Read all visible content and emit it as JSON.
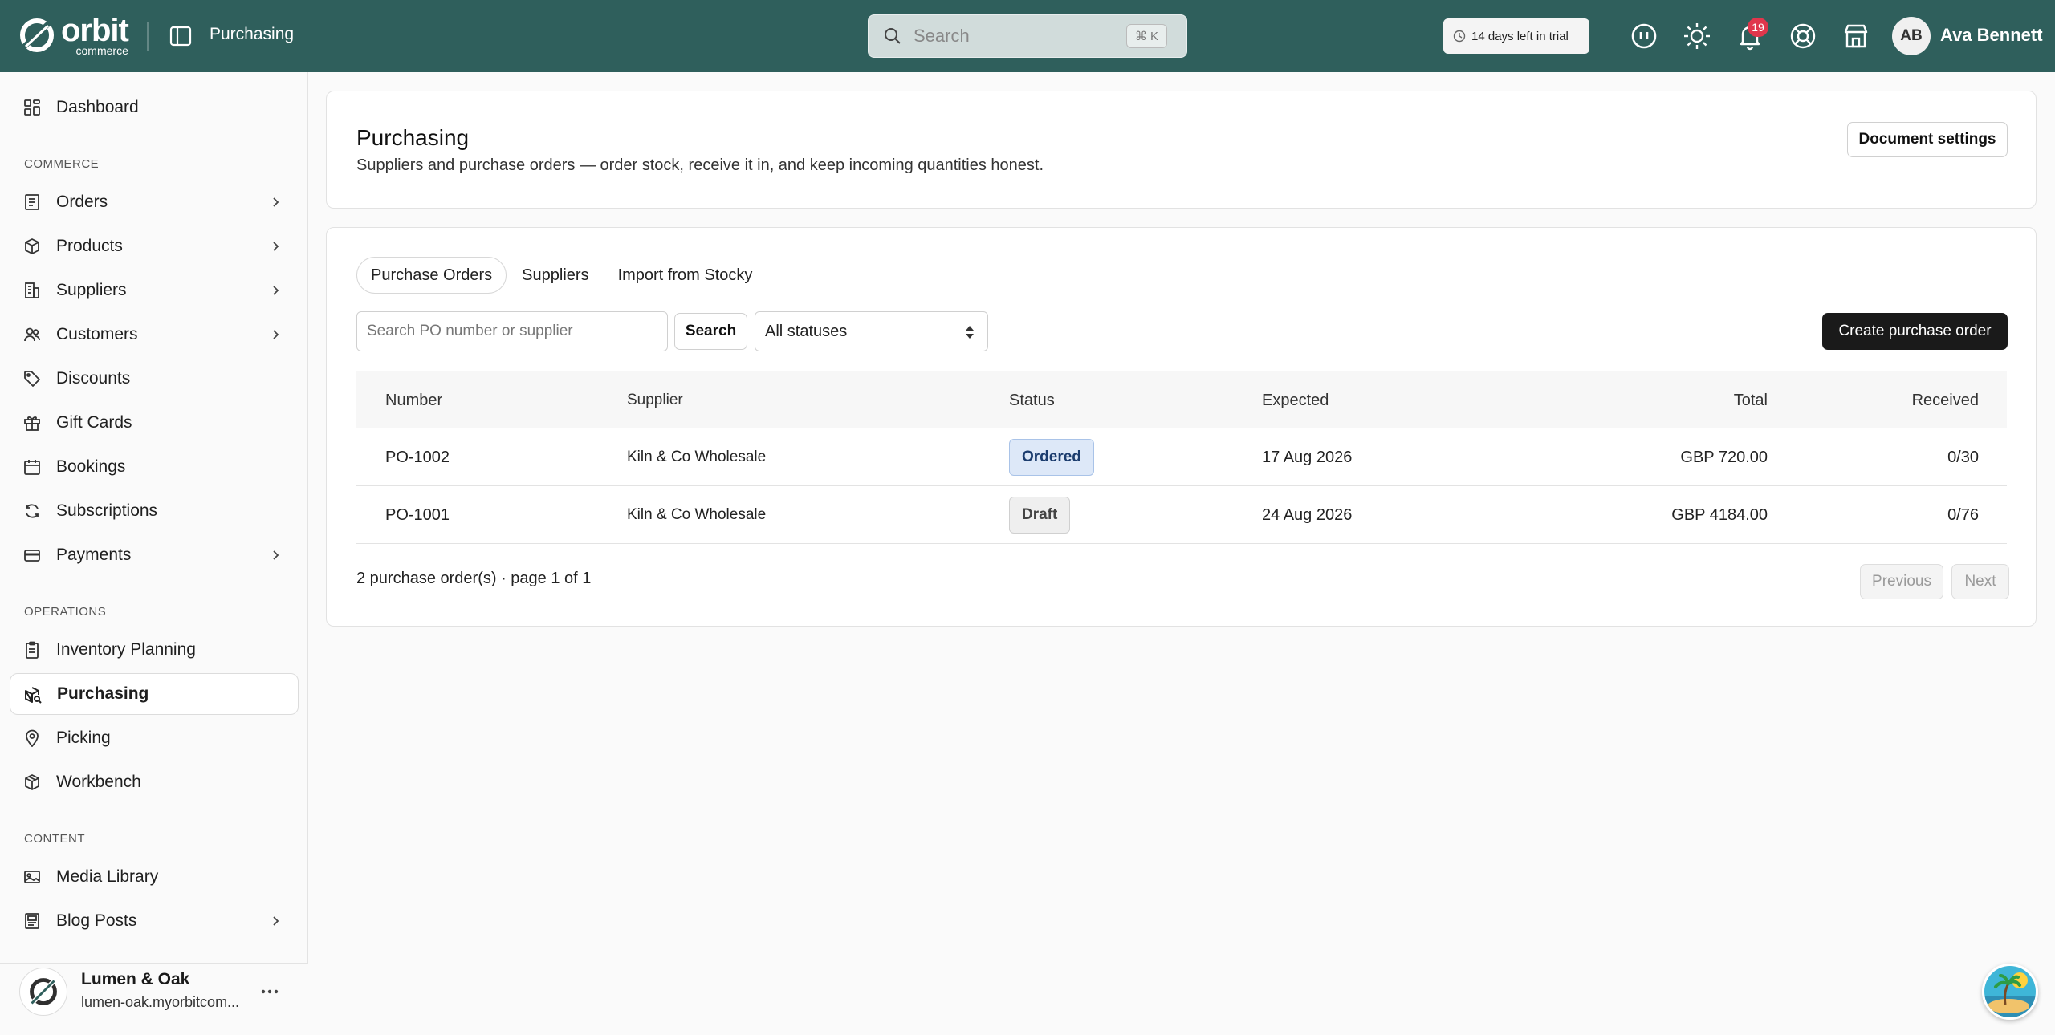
{
  "brand": {
    "name": "orbit",
    "sub": "commerce"
  },
  "topbar": {
    "section_title": "Purchasing",
    "search_placeholder": "Search",
    "search_shortcut": "⌘ K",
    "trial_text": "14 days left in trial",
    "notifications_count": "19",
    "user_initials": "AB",
    "user_name": "Ava Bennett",
    "icons": [
      "feedback-icon",
      "theme-toggle-icon",
      "bell-icon",
      "help-icon",
      "store-icon"
    ]
  },
  "sidebar": {
    "top_item": {
      "label": "Dashboard",
      "icon": "dashboard-icon"
    },
    "sections": {
      "commerce": "COMMERCE",
      "operations": "OPERATIONS",
      "content": "CONTENT"
    },
    "commerce_items": [
      {
        "label": "Orders",
        "icon": "orders-icon",
        "expandable": true
      },
      {
        "label": "Products",
        "icon": "box-icon",
        "expandable": true
      },
      {
        "label": "Suppliers",
        "icon": "building-icon",
        "expandable": true
      },
      {
        "label": "Customers",
        "icon": "users-icon",
        "expandable": true
      },
      {
        "label": "Discounts",
        "icon": "tag-icon",
        "expandable": false
      },
      {
        "label": "Gift Cards",
        "icon": "gift-icon",
        "expandable": false
      },
      {
        "label": "Bookings",
        "icon": "calendar-icon",
        "expandable": false
      },
      {
        "label": "Subscriptions",
        "icon": "refresh-icon",
        "expandable": false
      },
      {
        "label": "Payments",
        "icon": "card-icon",
        "expandable": true
      }
    ],
    "operations_items": [
      {
        "label": "Inventory Planning",
        "icon": "clipboard-icon"
      },
      {
        "label": "Purchasing",
        "icon": "box-tag-icon",
        "active": true
      },
      {
        "label": "Picking",
        "icon": "pin-icon"
      },
      {
        "label": "Workbench",
        "icon": "cube-icon"
      }
    ],
    "content_items": [
      {
        "label": "Media Library",
        "icon": "image-icon",
        "expandable": false
      },
      {
        "label": "Blog Posts",
        "icon": "blog-icon",
        "expandable": true
      }
    ],
    "store": {
      "name": "Lumen & Oak",
      "url": "lumen-oak.myorbitcom..."
    }
  },
  "header": {
    "title": "Purchasing",
    "description": "Suppliers and purchase orders — order stock, receive it in, and keep incoming quantities honest.",
    "document_settings_label": "Document settings"
  },
  "tabs": [
    {
      "label": "Purchase Orders",
      "active": true
    },
    {
      "label": "Suppliers",
      "active": false
    },
    {
      "label": "Import from Stocky",
      "active": false
    }
  ],
  "filters": {
    "search_placeholder": "Search PO number or supplier",
    "search_button": "Search",
    "status_selected": "All statuses",
    "create_button": "Create purchase order"
  },
  "table": {
    "columns": [
      "Number",
      "Supplier",
      "Status",
      "Expected",
      "Total",
      "Received"
    ],
    "rows": [
      {
        "number": "PO-1002",
        "supplier": "Kiln & Co Wholesale",
        "status": "Ordered",
        "expected": "17 Aug 2026",
        "total": "GBP 720.00",
        "received": "0/30"
      },
      {
        "number": "PO-1001",
        "supplier": "Kiln & Co Wholesale",
        "status": "Draft",
        "expected": "24 Aug 2026",
        "total": "GBP 4184.00",
        "received": "0/76"
      }
    ]
  },
  "pagination": {
    "summary": "2 purchase order(s) · page 1 of 1",
    "previous": "Previous",
    "next": "Next"
  },
  "colors": {
    "topbar": "#2f5f5c",
    "primary_button": "#1a1a1a",
    "ordered_badge": "#dde8f8",
    "notification_badge": "#e0364c"
  }
}
